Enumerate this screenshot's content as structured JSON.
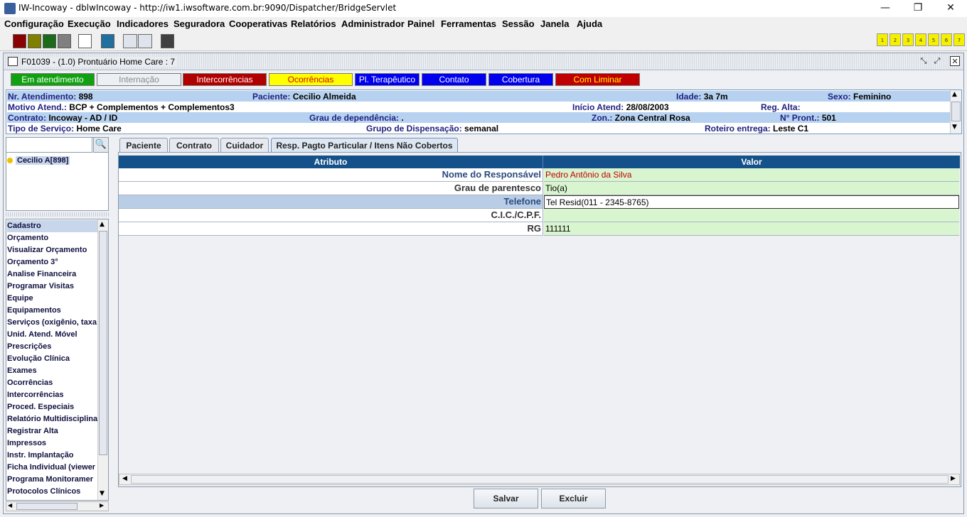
{
  "window": {
    "title": "IW-Incoway - dblwIncoway - http://iw1.iwsoftware.com.br:9090/Dispatcher/BridgeServlet",
    "minimize": "—",
    "maximize": "❐",
    "close": "✕"
  },
  "menu": [
    "Configuração",
    "Execução",
    "Indicadores",
    "Seguradora",
    "Cooperativas",
    "Relatórios",
    "Administrador",
    "Painel",
    "Ferramentas",
    "Sessão",
    "Janela",
    "Ajuda"
  ],
  "toolbar": {
    "color_buttons": [
      "#8b0000",
      "#808000",
      "#1a6b1a",
      "#808080",
      "#ffffff",
      "#1f6f9f",
      "#404040"
    ],
    "numbered_buttons": [
      "1",
      "2",
      "3",
      "4",
      "5",
      "6",
      "7"
    ]
  },
  "frame": {
    "title": "F01039 - (1.0) Prontuário Home Care : 7"
  },
  "status_tabs": [
    {
      "label": "Em atendimento",
      "bg": "#10a010",
      "fg": "#ffffff"
    },
    {
      "label": "Internação",
      "bg": "#eceff4",
      "fg": "#8a8a8a"
    },
    {
      "label": "Intercorrências",
      "bg": "#b00000",
      "fg": "#ffffff"
    },
    {
      "label": "Ocorrências",
      "bg": "#ffff00",
      "fg": "#d00000"
    },
    {
      "label": "Pl. Terapêutico",
      "bg": "#0000ee",
      "fg": "#ffffff"
    },
    {
      "label": "Contato",
      "bg": "#0000ee",
      "fg": "#ffffff"
    },
    {
      "label": "Cobertura",
      "bg": "#0000ee",
      "fg": "#ffffff"
    },
    {
      "label": "Com Liminar",
      "bg": "#c00000",
      "fg": "#ffff00"
    }
  ],
  "info": {
    "atendimento_label": "Nr. Atendimento:",
    "atendimento": "898",
    "paciente_label": "Paciente:",
    "paciente": "Cecilio Almeida",
    "idade_label": "Idade:",
    "idade": "3a 7m",
    "sexo_label": "Sexo:",
    "sexo": "Feminino",
    "motivo_label": "Motivo Atend.:",
    "motivo": "BCP + Complementos + Complementos3",
    "inicio_label": "Início Atend:",
    "inicio": "28/08/2003",
    "alta_label": "Reg. Alta:",
    "alta": "",
    "contrato_label": "Contrato:",
    "contrato": "Incoway - AD / ID",
    "grau_label": "Grau de dependência:",
    "grau": ".",
    "zona_label": "Zon.:",
    "zona": "Zona Central Rosa",
    "pront_label": "N° Pront.:",
    "pront": "501",
    "servico_label": "Tipo de Serviço:",
    "servico": "Home Care",
    "dispensacao_label": "Grupo de Dispensação:",
    "dispensacao": "semanal",
    "roteiro_label": "Roteiro entrega:",
    "roteiro": "Leste C1"
  },
  "left": {
    "search_placeholder": "",
    "patient": "Cecilio A[898]",
    "items": [
      "Cadastro",
      "Orçamento",
      "Visualizar Orçamento",
      "Orçamento 3°",
      "Analise Financeira",
      "Programar Visitas",
      "Equipe",
      "Equipamentos",
      "Serviços (oxigênio, taxa",
      "Unid. Atend. Móvel",
      "Prescrições",
      "Evolução Clínica",
      "Exames",
      "Ocorrências",
      "Intercorrências",
      "Proced. Especiais",
      "Relatório Multidisciplina",
      "Registrar Alta",
      "Impressos",
      "Instr. Implantação",
      "Ficha Individual (viewer",
      "Programa Monitoramer",
      "Protocolos Clínicos"
    ]
  },
  "tabs": [
    "Paciente",
    "Contrato",
    "Cuidador",
    "Resp. Pagto Particular / Itens Não Cobertos"
  ],
  "grid": {
    "headers": [
      "Atributo",
      "Valor"
    ],
    "rows": [
      {
        "attr": "Nome do Responsável",
        "value": "Pedro Antônio da Silva"
      },
      {
        "attr": "Grau de parentesco",
        "value": "Tio(a)"
      },
      {
        "attr": "Telefone",
        "value": "Tel Resid(011 - 2345-8765)"
      },
      {
        "attr": "C.I.C./C.P.F.",
        "value": ""
      },
      {
        "attr": "RG",
        "value": "111111"
      }
    ]
  },
  "buttons": {
    "save": "Salvar",
    "delete": "Excluir"
  }
}
